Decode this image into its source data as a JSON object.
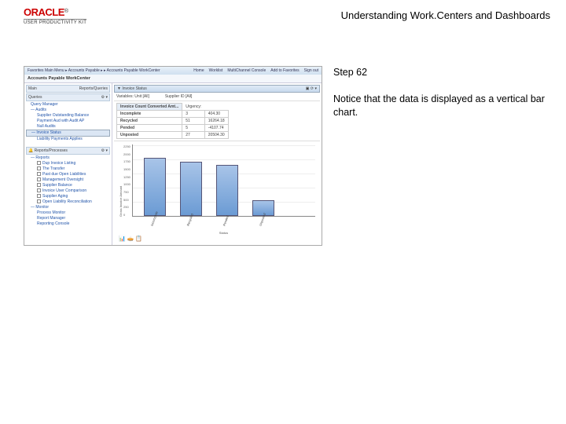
{
  "header": {
    "brand": "ORACLE",
    "tm": "®",
    "product": "USER PRODUCTIVITY KIT",
    "title": "Understanding Work.Centers and Dashboards"
  },
  "instruction": {
    "step": "Step 62",
    "text": "Notice that the data is displayed as a vertical bar chart."
  },
  "screenshot": {
    "topbar": {
      "left": "Favorites    Main Menu  ▸  Accounts Payable ▸ ▸ Accounts Payable WorkCenter",
      "menu": [
        "Home",
        "Worklist",
        "MultiChannel Console",
        "Add to Favorites",
        "Sign out"
      ]
    },
    "subheader": "Accounts Payable WorkCenter",
    "sidebar": {
      "tabs": [
        "Main",
        "Reports/Queries"
      ],
      "sections": [
        {
          "label": "Queries",
          "items": [
            "Query Manager"
          ]
        },
        {
          "label": "Audits",
          "items": [
            "Supplier Outstanding Balance",
            "Payment Aud with Audit AP",
            "Null Audits"
          ]
        },
        {
          "label": "Invoice Status",
          "items": [
            "Liability Payments Applies"
          ],
          "selected": true
        },
        {
          "label": "Reports/Processes",
          "items": []
        },
        {
          "label": "Reports",
          "items": [
            "Dup Invoice Listing",
            "The Transfer",
            "Past due Open Liabilities",
            "Management Oversight",
            "Supplier Balance",
            "Invoice User Comparison",
            "Supplier Aging",
            "Open Liability Reconciliation"
          ]
        },
        {
          "label": "Monitor",
          "items": [
            "Process Monitor",
            "Report Manager",
            "Reporting Console"
          ]
        }
      ]
    },
    "main": {
      "pagelet_title": "▼ Invoice Status",
      "filters": {
        "bu": "Variables: Unit [All]",
        "sup": "Supplier ID [All]"
      },
      "combo": "Invoice Count  Converted Amt...",
      "urgency": "Urgency:",
      "stats": [
        [
          "Incomplete",
          "3",
          "404.30"
        ],
        [
          "Recycled",
          "51",
          "16264.18"
        ],
        [
          "Pended",
          "5",
          "-4107.74"
        ],
        [
          "Unposted",
          "27",
          "20504.30"
        ]
      ],
      "icons": "📊 🥧 📋"
    }
  },
  "chart_data": {
    "type": "bar",
    "title": "",
    "xlabel": "Status",
    "ylabel": "Gross Invoice Amount",
    "ylim": [
      0,
      2250
    ],
    "categories": [
      "Incomplete",
      "Recycled",
      "Pended",
      "Unposted"
    ],
    "values": [
      1800,
      1700,
      1600,
      500
    ]
  }
}
